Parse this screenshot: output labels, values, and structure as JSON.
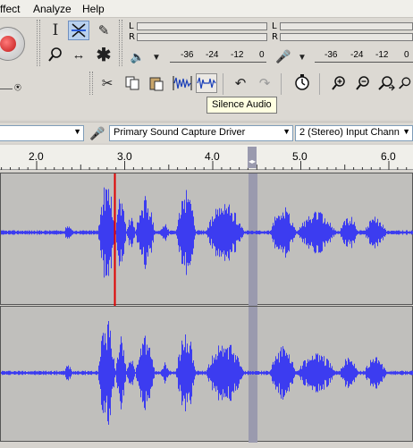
{
  "menu": {
    "effect": "ffect",
    "analyze": "Analyze",
    "help": "Help"
  },
  "meters": {
    "playback": {
      "channel_left": "L",
      "channel_right": "R"
    },
    "record": {
      "channel_left": "L",
      "channel_right": "R"
    },
    "ticks_playback": [
      "-36",
      "-24",
      "-12",
      "0"
    ],
    "ticks_record": [
      "-36",
      "-24",
      "-12",
      "0"
    ]
  },
  "tooltip": "Silence Audio",
  "device": {
    "input_source": "Primary Sound Capture Driver",
    "channels": "2 (Stereo) Input Chann"
  },
  "ruler": {
    "labels": [
      "2.0",
      "3.0",
      "4.0",
      "5.0",
      "6.0"
    ]
  },
  "icons": {
    "record": "record-icon",
    "selection": "selection-tool-icon",
    "envelope": "envelope-tool-icon",
    "draw": "draw-tool-icon",
    "zoom": "zoom-tool-icon",
    "timeshift": "timeshift-tool-icon",
    "multi": "multi-tool-icon",
    "speaker": "speaker-icon",
    "microphone": "microphone-icon",
    "cut": "cut-icon",
    "copy": "copy-icon",
    "paste": "paste-icon",
    "trim": "trim-icon",
    "silence": "silence-icon",
    "undo": "undo-icon",
    "redo": "redo-icon",
    "sync_lock": "sync-lock-icon",
    "zoom_in": "zoom-in-icon",
    "zoom_out": "zoom-out-icon",
    "fit_selection": "fit-selection-icon",
    "fit_project": "fit-project-icon"
  },
  "colors": {
    "waveform": "#3c3cf0",
    "playhead": "#e00000",
    "selection": "#9a9aae",
    "track_bg": "#c0bfbc"
  }
}
